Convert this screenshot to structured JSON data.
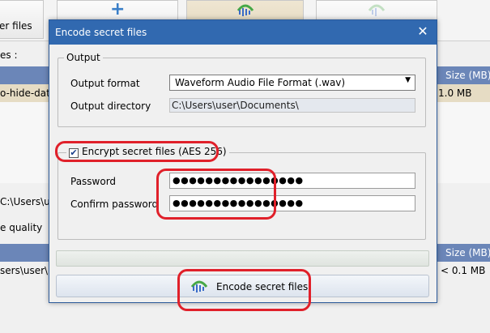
{
  "background": {
    "toolbar_left_label": "er files",
    "files_label": "es :",
    "left_row_text": "o-hide-data",
    "size_header_top": "Size (MB)",
    "size_value_top": "1.0 MB",
    "path_partial": "C:\\Users\\use",
    "quality_partial": "e quality",
    "size_header_bottom": "Size (MB)",
    "bottom_row_partial": "sers\\user\\De",
    "size_value_bottom": "< 0.1 MB"
  },
  "dialog": {
    "title": "Encode secret files",
    "close_glyph": "✕",
    "output": {
      "legend": "Output",
      "format_label": "Output format",
      "format_value": "Waveform Audio File Format (.wav)",
      "dir_label": "Output directory",
      "dir_value": "C:\\Users\\user\\Documents\\"
    },
    "encryption": {
      "checkbox_label": "Encrypt secret files (AES 256)",
      "checked_glyph": "✔",
      "password_label": "Password",
      "password_value": "●●●●●●●●●●●●●●●●",
      "confirm_label": "Confirm password",
      "confirm_value": "●●●●●●●●●●●●●●●●"
    },
    "encode_button_label": "Encode secret files"
  },
  "colors": {
    "titlebar": "#3169b0",
    "annotation": "#e0202a"
  },
  "icons": {
    "dropdown": "chevron-down-icon",
    "encode": "waveform-icon"
  }
}
